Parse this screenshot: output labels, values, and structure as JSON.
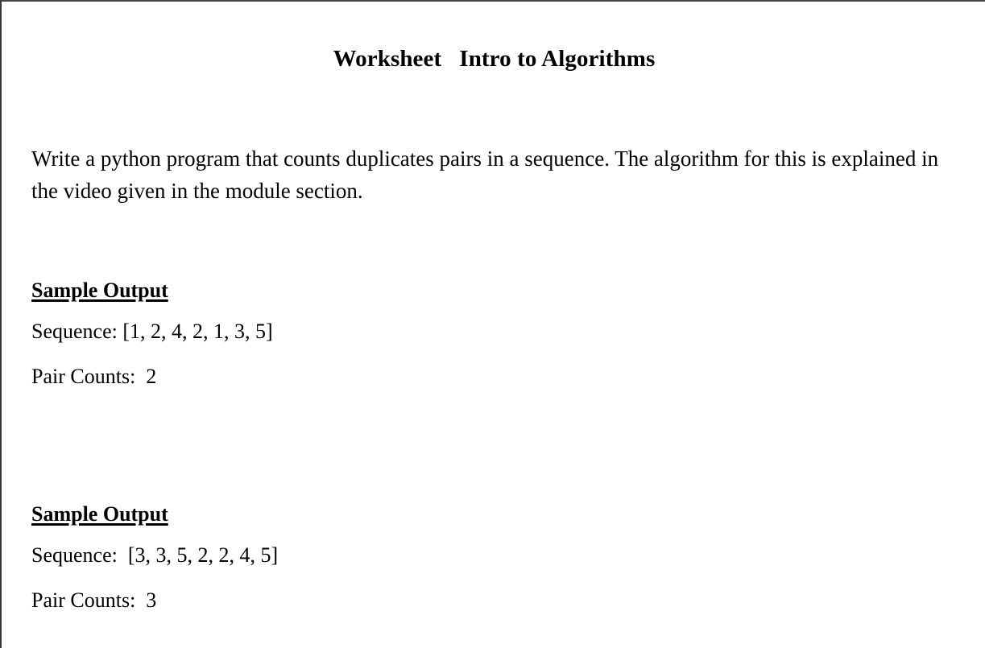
{
  "document": {
    "title": "Worksheet   Intro to Algorithms",
    "intro_paragraph": "Write a python program that counts duplicates pairs in a sequence. The algorithm for this is explained in the video given in the module section.",
    "samples": [
      {
        "heading": "Sample Output",
        "sequence_line": "Sequence: [1, 2, 4, 2, 1, 3, 5]",
        "sequence_label": "Sequence:",
        "sequence_values": [
          1,
          2,
          4,
          2,
          1,
          3,
          5
        ],
        "pair_counts_line": "Pair Counts:  2",
        "pair_counts_label": "Pair Counts:",
        "pair_counts_value": 2
      },
      {
        "heading": "Sample Output",
        "sequence_line": "Sequence:  [3, 3, 5, 2, 2, 4, 5]",
        "sequence_label": "Sequence:",
        "sequence_values": [
          3,
          3,
          5,
          2,
          2,
          4,
          5
        ],
        "pair_counts_line": "Pair Counts:  3",
        "pair_counts_label": "Pair Counts:",
        "pair_counts_value": 3
      }
    ]
  },
  "colors": {
    "text": "#000000",
    "page_background": "#ffffff",
    "border": "#38383c"
  }
}
